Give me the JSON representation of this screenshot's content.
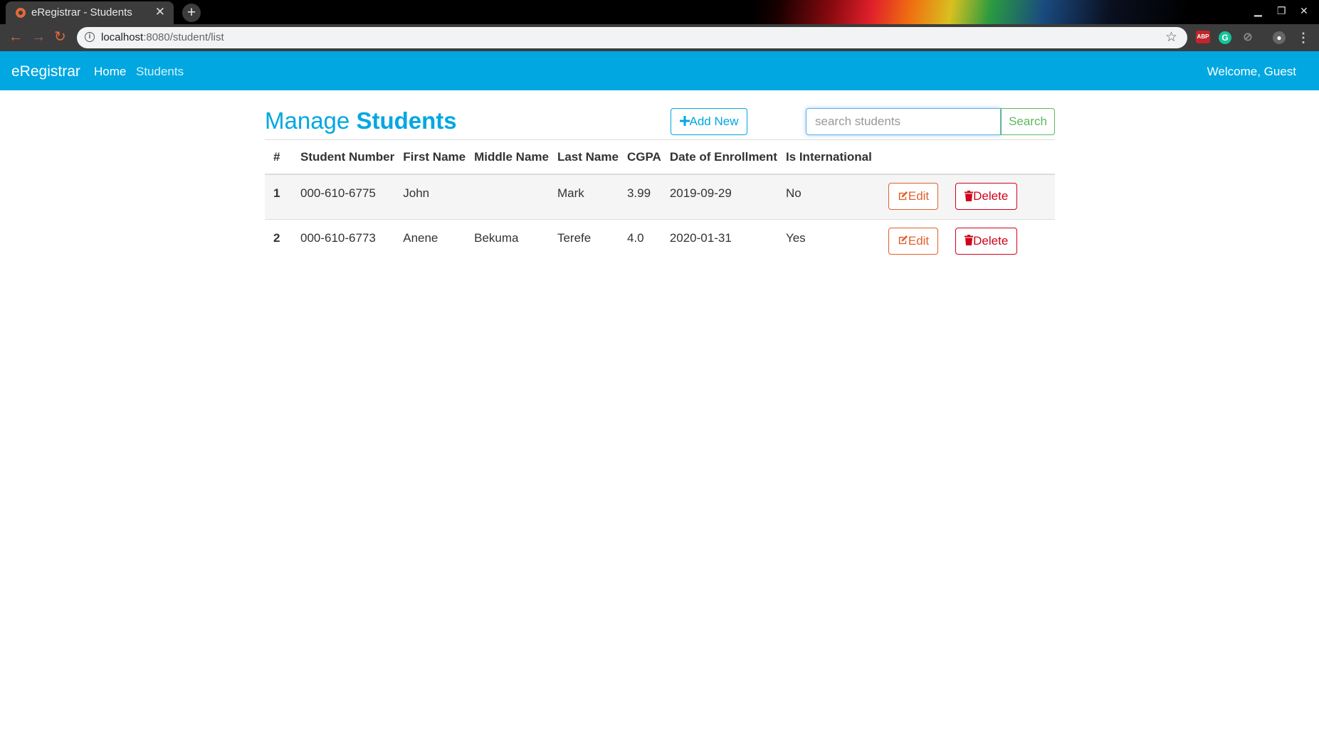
{
  "browser": {
    "tab_title": "eRegistrar - Students",
    "url_host": "localhost",
    "url_rest": ":8080/student/list",
    "extensions": [
      "ABP",
      "G"
    ]
  },
  "navbar": {
    "brand": "eRegistrar",
    "links": [
      "Home",
      "Students"
    ],
    "welcome": "Welcome, Guest",
    "color": "#00a7e1"
  },
  "page": {
    "title_prefix": "Manage",
    "title_strong": "Students",
    "add_label": "Add New",
    "search_placeholder": "search students",
    "search_label": "Search"
  },
  "table": {
    "headers": [
      "#",
      "Student Number",
      "First Name",
      "Middle Name",
      "Last Name",
      "CGPA",
      "Date of Enrollment",
      "Is International"
    ],
    "rows": [
      {
        "num": "1",
        "student_number": "000-610-6775",
        "first_name": "John",
        "middle_name": "",
        "last_name": "Mark",
        "cgpa": "3.99",
        "enrolled": "2019-09-29",
        "international": "No"
      },
      {
        "num": "2",
        "student_number": "000-610-6773",
        "first_name": "Anene",
        "middle_name": "Bekuma",
        "last_name": "Terefe",
        "cgpa": "4.0",
        "enrolled": "2020-01-31",
        "international": "Yes"
      }
    ],
    "edit_label": "Edit",
    "delete_label": "Delete"
  }
}
